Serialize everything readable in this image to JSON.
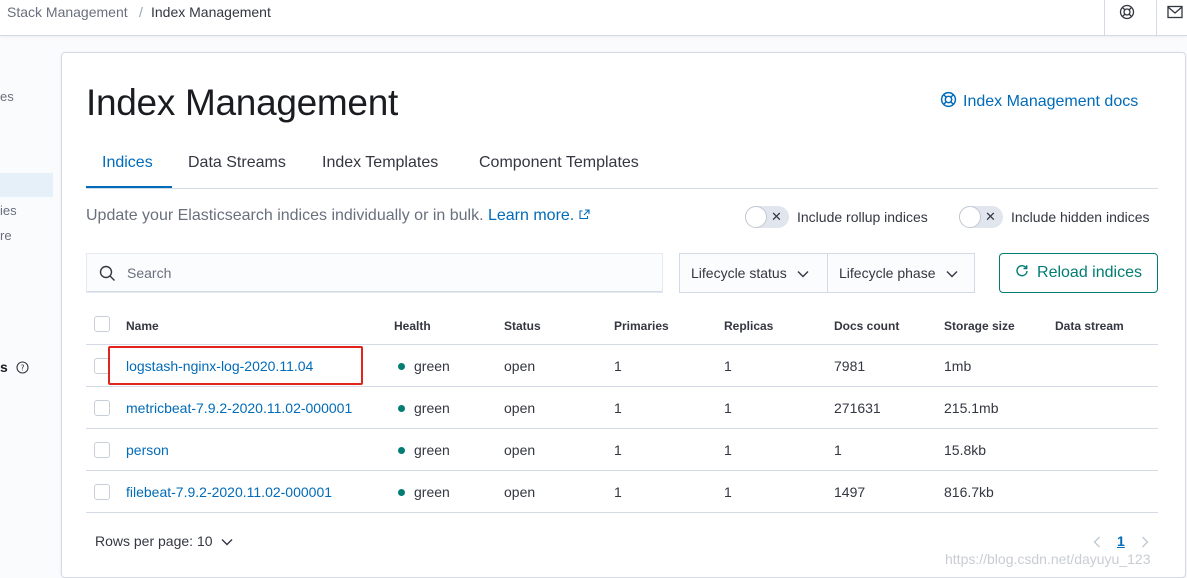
{
  "breadcrumbs": [
    "Stack Management",
    "Index Management"
  ],
  "breadcrumb_separator": "/",
  "sidebar_fragments": [
    "es",
    "ies",
    "re",
    "s"
  ],
  "page": {
    "title": "Index Management",
    "docs_link": "Index Management docs"
  },
  "tabs": [
    {
      "label": "Indices",
      "active": true
    },
    {
      "label": "Data Streams",
      "active": false
    },
    {
      "label": "Index Templates",
      "active": false
    },
    {
      "label": "Component Templates",
      "active": false
    }
  ],
  "description": {
    "text": "Update your Elasticsearch indices individually or in bulk.",
    "link": "Learn more."
  },
  "toggles": [
    {
      "label": "Include rollup indices",
      "on": false
    },
    {
      "label": "Include hidden indices",
      "on": false
    }
  ],
  "search": {
    "placeholder": "Search",
    "value": ""
  },
  "filters": [
    {
      "label": "Lifecycle status"
    },
    {
      "label": "Lifecycle phase"
    }
  ],
  "reload_label": "Reload indices",
  "table": {
    "columns": [
      "Name",
      "Health",
      "Status",
      "Primaries",
      "Replicas",
      "Docs count",
      "Storage size",
      "Data stream"
    ],
    "rows": [
      {
        "name": "logstash-nginx-log-2020.11.04",
        "health": "green",
        "status": "open",
        "primaries": "1",
        "replicas": "1",
        "docs_count": "7981",
        "storage_size": "1mb",
        "data_stream": ""
      },
      {
        "name": "metricbeat-7.9.2-2020.11.02-000001",
        "health": "green",
        "status": "open",
        "primaries": "1",
        "replicas": "1",
        "docs_count": "271631",
        "storage_size": "215.1mb",
        "data_stream": ""
      },
      {
        "name": "person",
        "health": "green",
        "status": "open",
        "primaries": "1",
        "replicas": "1",
        "docs_count": "1",
        "storage_size": "15.8kb",
        "data_stream": ""
      },
      {
        "name": "filebeat-7.9.2-2020.11.02-000001",
        "health": "green",
        "status": "open",
        "primaries": "1",
        "replicas": "1",
        "docs_count": "1497",
        "storage_size": "816.7kb",
        "data_stream": ""
      }
    ]
  },
  "pagination": {
    "rows_per_page_label": "Rows per page: 10",
    "current_page": "1"
  },
  "watermark": "https://blog.csdn.net/dayuyu_123",
  "colors": {
    "link": "#006bb8",
    "health_green": "#017d73",
    "reload_accent": "#017d73",
    "highlight_box": "#e0251f"
  },
  "icons": [
    "help-icon",
    "mail-icon",
    "docs-icon",
    "external-link-icon",
    "search-icon",
    "chevron-down-icon",
    "refresh-icon",
    "question-circle-icon",
    "chevron-left-icon",
    "chevron-right-icon"
  ]
}
